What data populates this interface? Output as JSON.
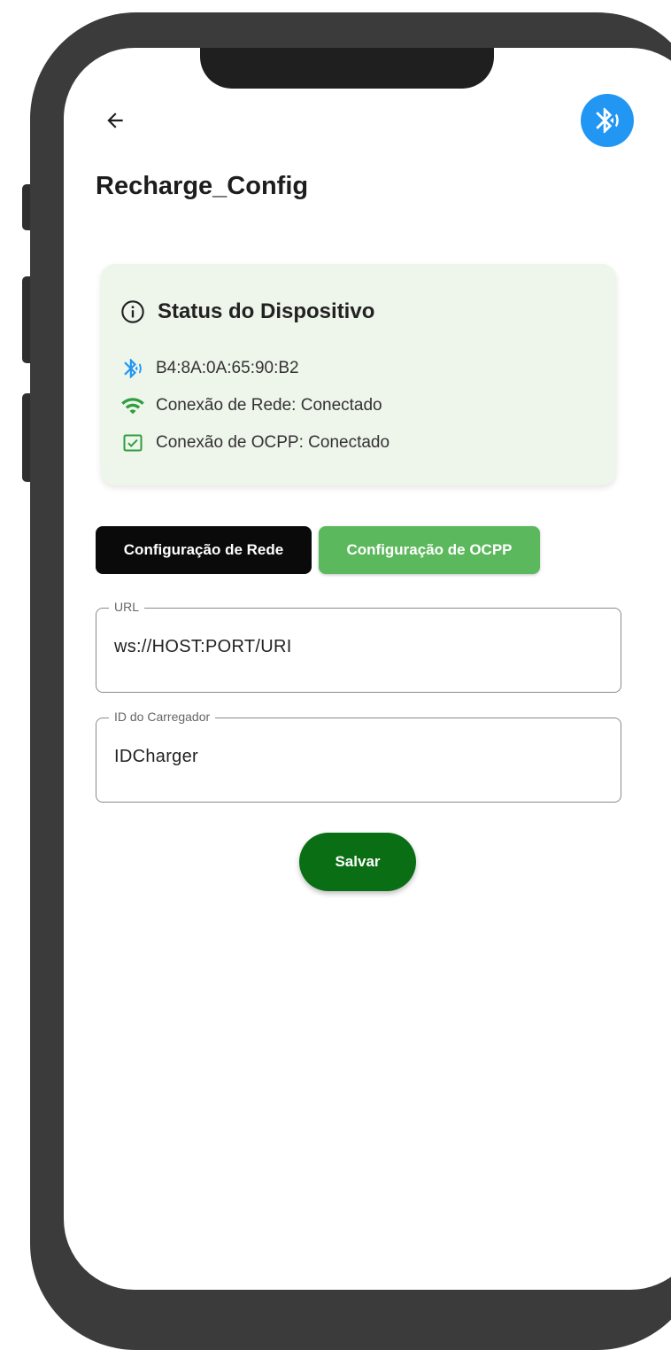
{
  "header": {
    "back_icon": "arrow-left-icon",
    "bluetooth_icon": "bluetooth-searching-icon",
    "title": "Recharge_Config"
  },
  "status_card": {
    "title": "Status do Dispositivo",
    "info_icon": "info-icon",
    "rows": [
      {
        "icon": "bluetooth-icon",
        "text": "B4:8A:0A:65:90:B2",
        "color": "#2196f3"
      },
      {
        "icon": "wifi-icon",
        "text": "Conexão de Rede: Conectado",
        "color": "#2e9e3e"
      },
      {
        "icon": "checkbox-icon",
        "text": "Conexão de OCPP: Conectado",
        "color": "#2e9e3e"
      }
    ]
  },
  "tabs": [
    {
      "label": "Configuração de Rede",
      "active": false
    },
    {
      "label": "Configuração de OCPP",
      "active": true
    }
  ],
  "fields": {
    "url": {
      "label": "URL",
      "value": "ws://HOST:PORT/URI"
    },
    "charger_id": {
      "label": "ID do Carregador",
      "value": "IDCharger"
    }
  },
  "save_label": "Salvar",
  "colors": {
    "accent_blue": "#2196f3",
    "green_tab": "#5cb85c",
    "save_green": "#0a6e14",
    "card_bg": "#eef5eb"
  }
}
